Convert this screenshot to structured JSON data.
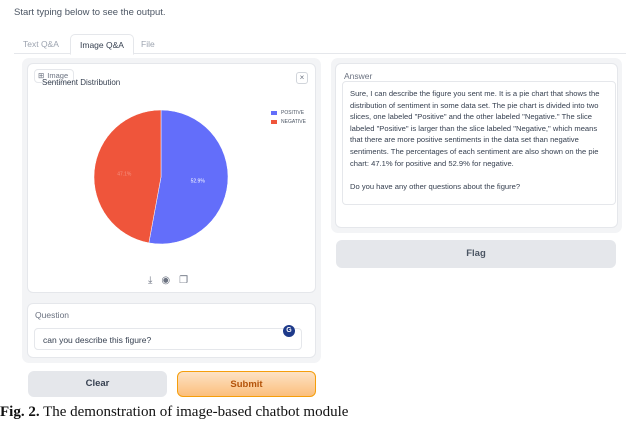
{
  "hint": "Start typing below to see the output.",
  "tabs": [
    {
      "label": "Text Q&A"
    },
    {
      "label": "Image Q&A"
    },
    {
      "label": "File"
    }
  ],
  "image_panel": {
    "label": "Image",
    "close_glyph": "×",
    "toolbar_icons": [
      "download-icon",
      "share-icon",
      "copy-icon"
    ]
  },
  "chart_data": {
    "type": "pie",
    "title": "Sentiment Distribution",
    "labels": [
      "POSITIVE",
      "NEGATIVE"
    ],
    "values": [
      52.9,
      47.1
    ],
    "slice_labels": [
      "52.9%",
      "47.1%"
    ],
    "colors": [
      "#636efa",
      "#ef553b"
    ],
    "legend_position": "top-right"
  },
  "question": {
    "label": "Question",
    "value": "can you describe this figure?",
    "badge": "G"
  },
  "buttons": {
    "clear": "Clear",
    "submit": "Submit",
    "flag": "Flag"
  },
  "answer": {
    "label": "Answer",
    "text": "Sure, I can describe the figure you sent me. It is a pie chart that shows the distribution of sentiment in some data set. The pie chart is divided into two slices, one labeled \"Positive\" and the other labeled \"Negative.\" The slice labeled \"Positive\" is larger than the slice labeled \"Negative,\" which means that there are more positive sentiments in the data set than negative sentiments. The percentages of each sentiment are also shown on the pie chart: 47.1% for positive and 52.9% for negative.\n\nDo you have any other questions about the figure?"
  },
  "caption": {
    "prefix": "Fig. 2.",
    "text": " The demonstration of image-based chatbot module"
  }
}
